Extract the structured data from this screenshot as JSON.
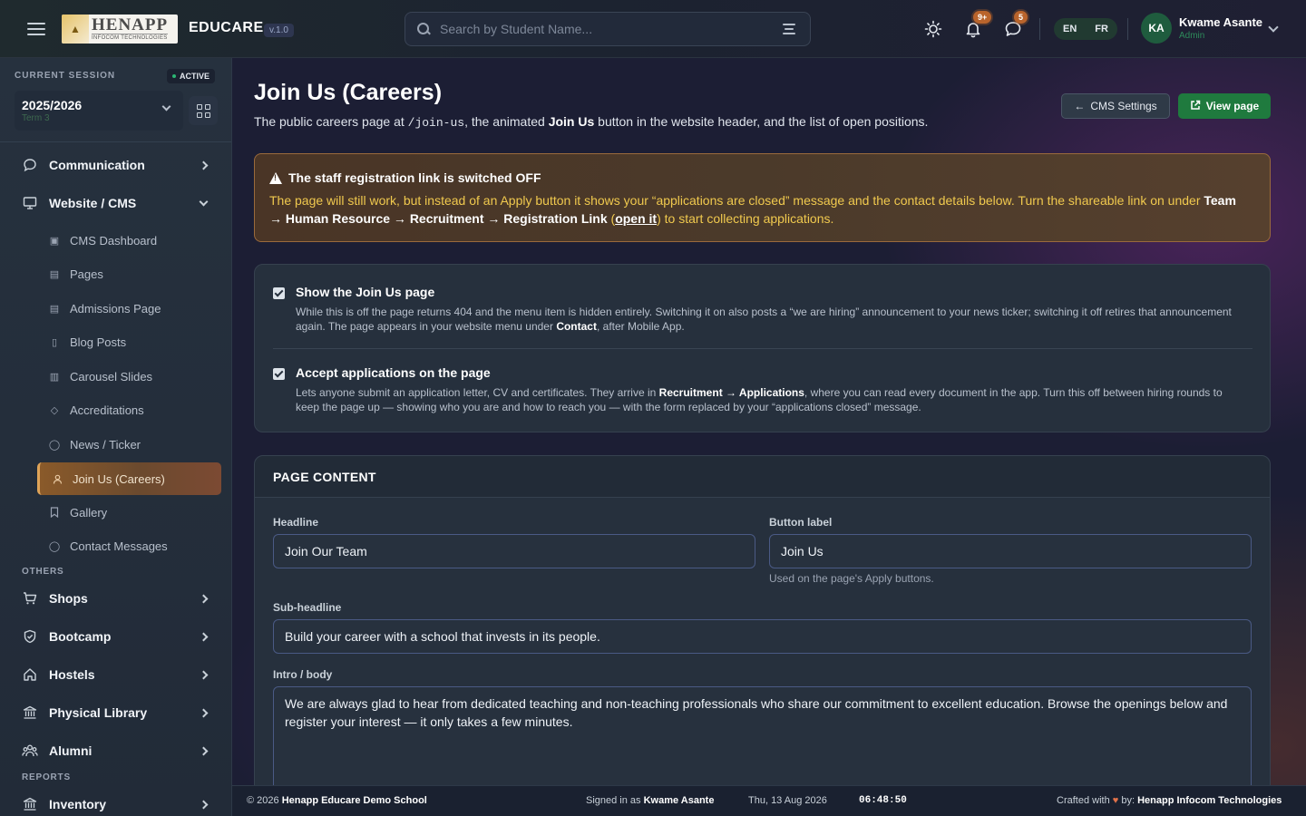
{
  "header": {
    "logo_main": "HENAPP",
    "logo_sub": "INFOCOM TECHNOLOGIES",
    "app_name": "EDUCARE",
    "version": "v.1.0",
    "search_placeholder": "Search by Student Name...",
    "notifications_count": "9+",
    "messages_count": "5",
    "lang_en": "EN",
    "lang_fr": "FR",
    "user_initials": "KA",
    "user_name": "Kwame Asante",
    "user_role": "Admin"
  },
  "sidebar": {
    "session_label": "CURRENT SESSION",
    "session_status": "ACTIVE",
    "session_year": "2025/2026",
    "session_term": "Term 3",
    "main_items": [
      {
        "label": "Communication"
      },
      {
        "label": "Website / CMS"
      }
    ],
    "cms_items": [
      {
        "label": "CMS Dashboard"
      },
      {
        "label": "Pages"
      },
      {
        "label": "Admissions Page"
      },
      {
        "label": "Blog Posts"
      },
      {
        "label": "Carousel Slides"
      },
      {
        "label": "Accreditations"
      },
      {
        "label": "News / Ticker"
      },
      {
        "label": "Join Us (Careers)"
      },
      {
        "label": "Gallery"
      },
      {
        "label": "Contact Messages"
      }
    ],
    "others_label": "OTHERS",
    "others_items": [
      {
        "label": "Shops"
      },
      {
        "label": "Bootcamp"
      },
      {
        "label": "Hostels"
      },
      {
        "label": "Physical Library"
      },
      {
        "label": "Alumni"
      }
    ],
    "reports_label": "REPORTS",
    "reports_items": [
      {
        "label": "Inventory"
      }
    ]
  },
  "page": {
    "title": "Join Us (Careers)",
    "desc_1": "The public careers page at ",
    "desc_path": "/join-us",
    "desc_2": ", the animated ",
    "desc_bold": "Join Us",
    "desc_3": " button in the website header, and the list of open positions.",
    "cms_settings_label": "CMS Settings",
    "view_page_label": "View page"
  },
  "alert": {
    "title": "The staff registration link is switched OFF",
    "body_1": "The page will still work, but instead of an Apply button it shows your “applications are closed” message and the contact details below. Turn the shareable link on under ",
    "path": "Team → Human Resource → Recruitment → Registration Link",
    "body_2": " (",
    "link": "open it",
    "body_3": ") to start collecting applications."
  },
  "toggles": [
    {
      "title": "Show the Join Us page",
      "desc_1": "While this is off the page returns 404 and the menu item is hidden entirely. Switching it on also posts a “we are hiring” announcement to your news ticker; switching it off retires that announcement again. The page appears in your website menu under ",
      "desc_bold": "Contact",
      "desc_2": ", after Mobile App."
    },
    {
      "title": "Accept applications on the page",
      "desc_1": "Lets anyone submit an application letter, CV and certificates. They arrive in ",
      "desc_bold": "Recruitment → Applications",
      "desc_2": ", where you can read every document in the app. Turn this off between hiring rounds to keep the page up — showing who you are and how to reach you — with the form replaced by your “applications closed” message."
    }
  ],
  "content": {
    "section_title": "PAGE CONTENT",
    "headline_label": "Headline",
    "headline_value": "Join Our Team",
    "button_label_label": "Button label",
    "button_label_value": "Join Us",
    "button_label_help": "Used on the page's Apply buttons.",
    "subheadline_label": "Sub-headline",
    "subheadline_value": "Build your career with a school that invests in its people.",
    "intro_label": "Intro / body",
    "intro_value": "We are always glad to hear from dedicated teaching and non-teaching professionals who share our commitment to excellent education. Browse the openings below and register your interest — it only takes a few minutes."
  },
  "footer": {
    "copyright": "© 2026 ",
    "school": "Henapp Educare Demo School",
    "signed_in_prefix": "Signed in as ",
    "signed_in_user": "Kwame Asante",
    "date": "Thu, 13 Aug 2026",
    "time": "06:48:50",
    "crafted_prefix": "Crafted with ",
    "heart": "♥",
    "crafted_by": " by: ",
    "company": "Henapp Infocom Technologies"
  },
  "colors": {
    "accent_green": "#1f7a3e",
    "active_nav": "#8a5a2a",
    "warning_text": "#f0c94e",
    "notification_badge": "#b9642c"
  }
}
